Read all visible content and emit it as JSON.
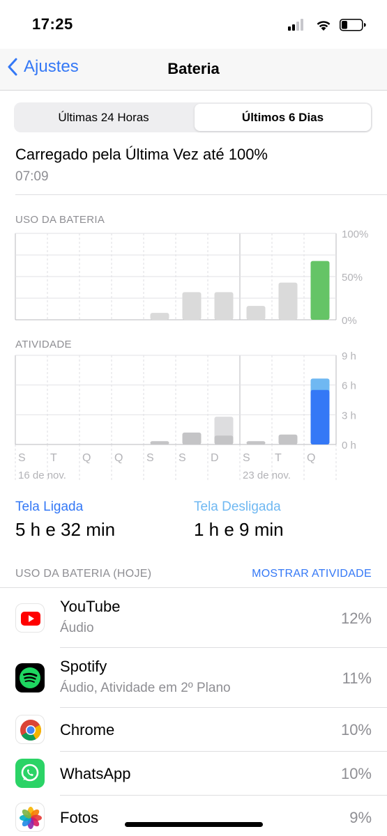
{
  "status_bar": {
    "time": "17:25"
  },
  "nav": {
    "back_label": "Ajustes",
    "title": "Bateria"
  },
  "segmented": {
    "left": "Últimas 24 Horas",
    "right": "Últimos 6 Dias",
    "selected": "right"
  },
  "last_charge": {
    "label": "Carregado pela Última Vez até 100%",
    "time": "07:09"
  },
  "chart_data": [
    {
      "type": "bar",
      "title": "USO DA BATERIA",
      "categories": [
        "S",
        "T",
        "Q",
        "Q",
        "S",
        "S",
        "D",
        "S",
        "T",
        "Q"
      ],
      "series": [
        {
          "values": [
            0,
            0,
            0,
            0,
            8,
            32,
            32,
            16,
            43,
            68
          ]
        }
      ],
      "y_ticks": [
        "100%",
        "50%",
        "0%"
      ],
      "ylim": [
        0,
        100
      ],
      "highlight_color": "#65c466",
      "bar_color": "#dadada"
    },
    {
      "type": "bar",
      "title": "ATIVIDADE",
      "categories": [
        "S",
        "T",
        "Q",
        "Q",
        "S",
        "S",
        "D",
        "S",
        "T",
        "Q"
      ],
      "series": [
        {
          "values": [
            0,
            0,
            0,
            0,
            0.33,
            1.2,
            0.9,
            0.33,
            1.0,
            5.5
          ]
        },
        {
          "values": [
            0,
            0,
            0,
            0,
            0,
            0,
            1.9,
            0,
            0,
            1.15
          ]
        }
      ],
      "y_ticks": [
        "9 h",
        "6 h",
        "3 h",
        "0 h"
      ],
      "ylim": [
        0,
        9
      ],
      "date_labels": [
        "16 de nov.",
        "23 de nov."
      ],
      "colors": {
        "on": "#3478f6",
        "off": "#6fb8f2",
        "past_on": "#c4c4c6",
        "past_off": "#dddddf"
      }
    }
  ],
  "summary": {
    "screen_on_label": "Tela Ligada",
    "screen_on_value": "5 h e 32 min",
    "screen_off_label": "Tela Desligada",
    "screen_off_value": "1 h e 9 min",
    "screen_on_color": "#3478f6",
    "screen_off_color": "#6fb8f2"
  },
  "usage": {
    "header": "USO DA BATERIA (HOJE)",
    "action": "MOSTRAR ATIVIDADE",
    "apps": [
      {
        "name": "YouTube",
        "subtitle": "Áudio",
        "percent": "12%",
        "icon": "youtube-icon"
      },
      {
        "name": "Spotify",
        "subtitle": "Áudio, Atividade em 2º Plano",
        "percent": "11%",
        "icon": "spotify-icon"
      },
      {
        "name": "Chrome",
        "subtitle": "",
        "percent": "10%",
        "icon": "chrome-icon"
      },
      {
        "name": "WhatsApp",
        "subtitle": "",
        "percent": "10%",
        "icon": "whatsapp-icon"
      },
      {
        "name": "Fotos",
        "subtitle": "",
        "percent": "9%",
        "icon": "photos-icon"
      }
    ]
  }
}
